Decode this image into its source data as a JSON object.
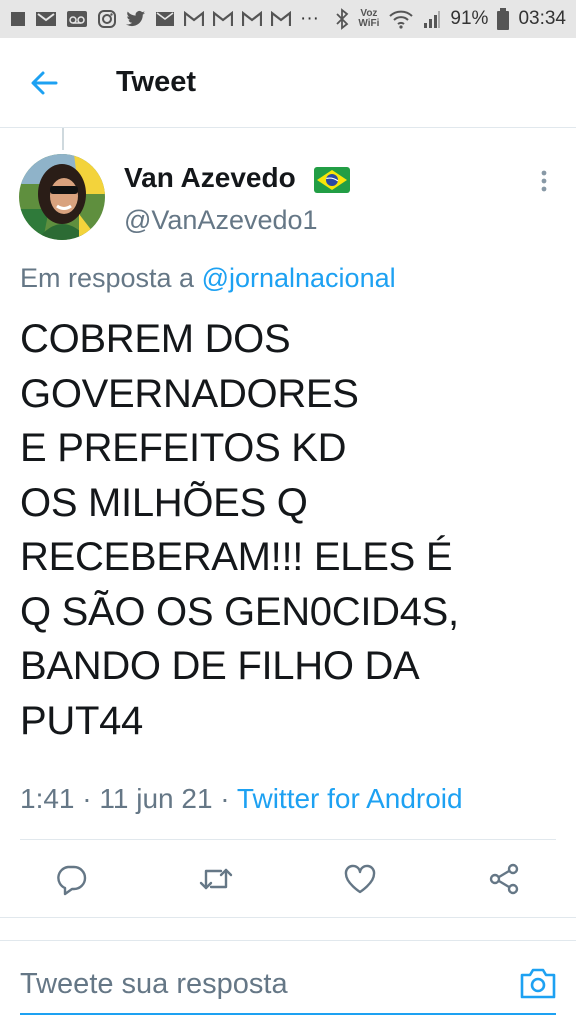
{
  "status_bar": {
    "battery_percent": "91%",
    "time": "03:34",
    "voz_wifi_top": "Voz",
    "voz_wifi_bottom": "WiFi",
    "ellipsis": "···",
    "left_icons": [
      "square-notification-icon",
      "mail-icon",
      "voicemail-icon",
      "instagram-icon",
      "twitter-icon",
      "email-icon",
      "gmail-icon",
      "gmail-icon",
      "gmail-icon",
      "gmail-icon"
    ],
    "right_icons": [
      "bluetooth-icon",
      "wifi-icon",
      "signal-icon",
      "battery-icon"
    ]
  },
  "header": {
    "title": "Tweet",
    "back_icon": "back-arrow-icon"
  },
  "tweet": {
    "author": {
      "display_name": "Van Azevedo",
      "flag_icon": "brazil-flag-icon",
      "handle": "@VanAzevedo1"
    },
    "reply_prefix": "Em resposta a ",
    "reply_to": "@jornalnacional",
    "text": "COBREM DOS\nGOVERNADORES\nE PREFEITOS KD\nOS MILHÕES Q\nRECEBERAM!!! ELES É\nQ SÃO OS GEN0CID4S,\nBANDO DE FILHO DA\nPUT44",
    "time": "1:41",
    "separator": " · ",
    "date": "11 jun 21",
    "source": "Twitter for Android"
  },
  "actions": [
    "reply-icon",
    "retweet-icon",
    "like-icon",
    "share-icon"
  ],
  "reply_bar": {
    "placeholder": "Tweete sua resposta",
    "camera_icon": "camera-icon"
  },
  "colors": {
    "accent": "#1da1f2",
    "secondary_text": "#657786",
    "primary_text": "#14171a",
    "divider": "#e1e8ed",
    "status_bar_bg": "#e6e6e6"
  }
}
